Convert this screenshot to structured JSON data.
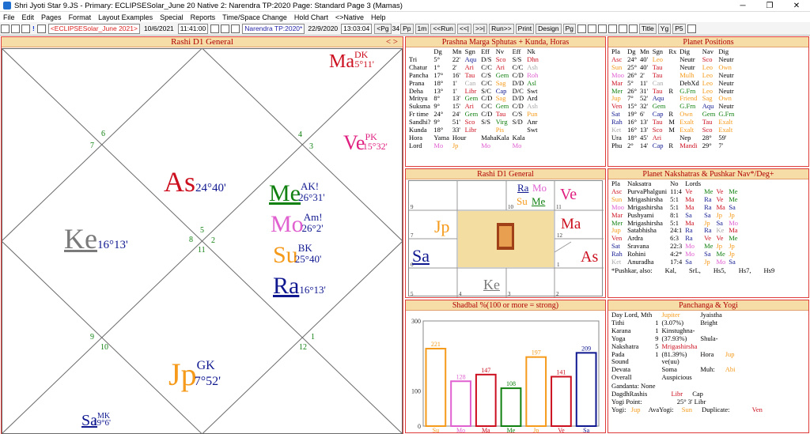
{
  "window": {
    "title": "Shri Jyoti Star 9.JS  - Primary: ECLIPSESolar_June 20    Native 2: Narendra TP:2020    Page: Standard Page 3 (Mamas)"
  },
  "menu": [
    "File",
    "Edit",
    "Pages",
    "Format",
    "Layout Examples",
    "Special",
    "Reports",
    "Time/Space Change",
    "Hold Chart",
    "<>Native",
    "Help"
  ],
  "toolbar": {
    "primary": "<ECLIPSESolar_June 2021>",
    "date1": "10/6/2021",
    "time1": "11:41:00",
    "native2": "Narendra TP:2020*",
    "date2": "22/9/2020",
    "time2": "13:03:04",
    "pg": "<Pg",
    "pg_num": "34",
    "pp": "Pp",
    "one_m": "1m",
    "run_back": "<<Run",
    "back": "<<|",
    "fwd": ">>|",
    "run_fwd": "Run>>",
    "print": "Print",
    "design": "Design",
    "pg2": "Pg",
    "title_btn": "Title",
    "yg": "Yg",
    "p5": "P5"
  },
  "rashi_big": {
    "title": "Rashi D1  General",
    "nav": "< >",
    "houses": [
      "6",
      "7",
      "4",
      "3",
      "5",
      "8",
      "2",
      "11",
      "9",
      "10",
      "12",
      "1"
    ],
    "planets": {
      "ma": {
        "name": "Ma",
        "sup": "DK",
        "deg": "5°11'"
      },
      "ve": {
        "name": "Ve",
        "sup": "PK",
        "deg": "15°32'"
      },
      "as": {
        "name": "As",
        "deg": "24°40'"
      },
      "me": {
        "name": "Me",
        "sup": "AK!",
        "deg": "26°31'"
      },
      "mo": {
        "name": "Mo",
        "sup": "Am!",
        "deg": "26°2'"
      },
      "su": {
        "name": "Su",
        "sup": "BK",
        "deg": "25°40'"
      },
      "ra": {
        "name": "Ra",
        "deg": "16°13'"
      },
      "ke": {
        "name": "Ke",
        "deg": "16°13'"
      },
      "jp": {
        "name": "Jp",
        "sup": "GK",
        "deg": "7°52'"
      },
      "sa": {
        "name": "Sa",
        "sup": "MK",
        "deg": "19°6'"
      }
    }
  },
  "prashna": {
    "title": "Prashna Marga Sphutas + Kunda, Horas",
    "header": [
      "",
      "Dg",
      "Mn",
      "Sgn",
      "Eff",
      "Nv",
      "Eff",
      "Nk"
    ],
    "rows": [
      [
        "Tri",
        "5°",
        "22'",
        "Aqu",
        "D/S",
        "Sco",
        "S/S",
        "Dhn"
      ],
      [
        "Chatur",
        "1°",
        "2'",
        "Ari",
        "C/C",
        "Ari",
        "C/C",
        "Ash"
      ],
      [
        "Pancha",
        "17°",
        "16'",
        "Tau",
        "C/S",
        "Gem",
        "C/D",
        "Roh"
      ],
      [
        "Prana",
        "18°",
        "1'",
        "Can",
        "C/C",
        "Sag",
        "D/D",
        "Asl"
      ],
      [
        "Deha",
        "13°",
        "1'",
        "Libr",
        "S/C",
        "Cap",
        "D/C",
        "Swt"
      ],
      [
        "Mrityu",
        "8°",
        "13'",
        "Gem",
        "C/D",
        "Sag",
        "D/D",
        "Ard"
      ],
      [
        "Suksma",
        "9°",
        "15'",
        "Ari",
        "C/C",
        "Gem",
        "C/D",
        "Ash"
      ],
      [
        "Fr time",
        "24°",
        "24'",
        "Gem",
        "C/D",
        "Tau",
        "C/S",
        "Pun"
      ],
      [
        "Sandhi?",
        "9°",
        "51'",
        "Sco",
        "S/S",
        "Virg",
        "S/D",
        "Anr"
      ],
      [
        "Kunda",
        "18°",
        "33'",
        "Libr",
        "",
        "Pis",
        "",
        "Swt"
      ]
    ],
    "hora_row": [
      "Hora",
      "Yama",
      "Hour",
      "MahaKala",
      "Kala"
    ],
    "lord_row": [
      "Lord",
      "Mo",
      "Jp",
      "Mo",
      "Mo"
    ]
  },
  "positions": {
    "title": "Planet Positions",
    "header": [
      "Pla",
      "Dg",
      "Mn",
      "Sgn",
      "Rx",
      "Dig",
      "Nav",
      "Dig"
    ],
    "rows": [
      [
        "Asc",
        "24°",
        "40'",
        "Leo",
        "",
        "Neutr",
        "Sco",
        "Neutr"
      ],
      [
        "Sun",
        "25°",
        "40'",
        "Tau",
        "",
        "Neutr",
        "Leo",
        "Own"
      ],
      [
        "Moo",
        "26°",
        "2'",
        "Tau",
        "",
        "Mulh",
        "Leo",
        "Neutr"
      ],
      [
        "Mar",
        "5°",
        "11'",
        "Can",
        "",
        "DebXd",
        "Leo",
        "Neutr"
      ],
      [
        "Mer",
        "26°",
        "31'",
        "Tau",
        "R",
        "G.Frn",
        "Leo",
        "Neutr"
      ],
      [
        "Jup",
        "7°",
        "52'",
        "Aqu",
        "",
        "Friend",
        "Sag",
        "Own"
      ],
      [
        "Ven",
        "15°",
        "32'",
        "Gem",
        "",
        "G.Frn",
        "Aqu",
        "Neutr"
      ],
      [
        "Sat",
        "19°",
        "6'",
        "Cap",
        "R",
        "Own",
        "Gem",
        "G.Frn"
      ],
      [
        "Rah",
        "16°",
        "13'",
        "Tau",
        "M",
        "Exalt",
        "Tau",
        "Exalt"
      ],
      [
        "Ket",
        "16°",
        "13'",
        "Sco",
        "M",
        "Exalt",
        "Sco",
        "Exalt"
      ],
      [
        "Ura",
        "18°",
        "45'",
        "Ari",
        "",
        "Nep",
        "28°",
        "59'"
      ],
      [
        "Phu",
        "2°",
        "14'",
        "Cap",
        "R",
        "Mandi",
        "29°",
        "7'"
      ]
    ],
    "extra": [
      "Aqu",
      "Can"
    ]
  },
  "rashi_small": {
    "title": "Rashi D1 General",
    "houses": [
      "9",
      "10",
      "11",
      "7",
      "12",
      "6",
      "1",
      "5",
      "4",
      "3",
      "2"
    ],
    "ra": "Ra",
    "mo": "Mo",
    "su": "Su",
    "me": "Me",
    "ve": "Ve",
    "jp": "Jp",
    "ma": "Ma",
    "sa": "Sa",
    "as": "As",
    "ke": "Ke"
  },
  "nakshatras": {
    "title": "Planet Nakshatras & Pushkar Nav*/Deg+",
    "header": [
      "Pla",
      "Naksatra",
      "No",
      "Lords",
      "",
      "",
      ""
    ],
    "rows": [
      [
        "Asc",
        "PurvaPhalguni",
        "11:4",
        "Ve",
        "Me",
        "Ve",
        "Me"
      ],
      [
        "Sun",
        "Mrigashirsha",
        "5:1",
        "Ma",
        "Ra",
        "Ve",
        "Me"
      ],
      [
        "Moo",
        "Mrigashirsha",
        "5:1",
        "Ma",
        "Ra",
        "Ma",
        "Sa"
      ],
      [
        "Mar",
        "Pushyami",
        "8:1",
        "Sa",
        "Sa",
        "Jp",
        "Jp"
      ],
      [
        "Mer",
        "Mrigashirsha",
        "5:1",
        "Ma",
        "Jp",
        "Sa",
        "Mo"
      ],
      [
        "Jup",
        "Satabhisha",
        "24:1",
        "Ra",
        "Ra",
        "Ke",
        "Ma"
      ],
      [
        "Ven",
        "Ardra",
        "6:3",
        "Ra",
        "Ve",
        "Ve",
        "Me"
      ],
      [
        "Sat",
        "Sravana",
        "22:3",
        "Mo",
        "Me",
        "Jp",
        "Jp"
      ],
      [
        "Rah",
        "Rohini",
        "4:2*",
        "Mo",
        "Sa",
        "Me",
        "Jp"
      ],
      [
        "Ket",
        "Anuradha",
        "17:4",
        "Sa",
        "Jp",
        "Mo",
        "Sa"
      ]
    ],
    "pushkar": [
      "*Pushkar, also:",
      "Kal,",
      "SrL,",
      "Hs5,",
      "Hs7,",
      "Hs9"
    ]
  },
  "shadbal": {
    "title": "Shadbal %(100 or more = strong)"
  },
  "chart_data": {
    "type": "bar",
    "title": "Shadbal %(100 or more = strong)",
    "categories": [
      "Su",
      "Mo",
      "Ma",
      "Me",
      "Jp",
      "Ve",
      "Sa"
    ],
    "values": [
      221,
      128,
      147,
      108,
      197,
      141,
      209
    ],
    "ylim": [
      0,
      300
    ],
    "yticks": [
      "0",
      "100",
      "300"
    ],
    "colors": [
      "#f59a1a",
      "#e060d0",
      "#cc1020",
      "#108010",
      "#f59a1a",
      "#cc1020",
      "#101890"
    ]
  },
  "panchanga": {
    "title": "Panchanga & Yogi",
    "rows": [
      [
        "Day Lord, Mth",
        "",
        "Jupiter",
        "Jyaistha"
      ],
      [
        "Tithi",
        "1",
        "(3.07%)",
        "Bright"
      ],
      [
        "Karana",
        "1",
        "Kinstughna-",
        ""
      ],
      [
        "Yoga",
        "9",
        "(37.93%)",
        "Shula-"
      ],
      [
        "Nakshatra",
        "5",
        "Mrigashirsha",
        ""
      ],
      [
        "Pada",
        "1",
        "(81.39%)",
        "Hora",
        "Jup"
      ],
      [
        "Sound",
        "",
        "ve(uu)",
        ""
      ],
      [
        "Devata",
        "",
        "Soma",
        "Muh:",
        "Abi"
      ],
      [
        "Overall",
        "",
        "Auspicious",
        ""
      ]
    ],
    "gandanta": "Gandanta: None",
    "dagdh": "DagdhRashis",
    "dagdh_v1": "Libr",
    "dagdh_v2": "Cap",
    "yogi_point": "Yogi Point:",
    "yogi_deg": "25°  3' Libr",
    "yogi": "Yogi:",
    "yogi_v": "Jup",
    "avayogi": "AvaYogi:",
    "avayogi_v": "Sun",
    "dup": "Duplicate:",
    "dup_v": "Ven"
  }
}
